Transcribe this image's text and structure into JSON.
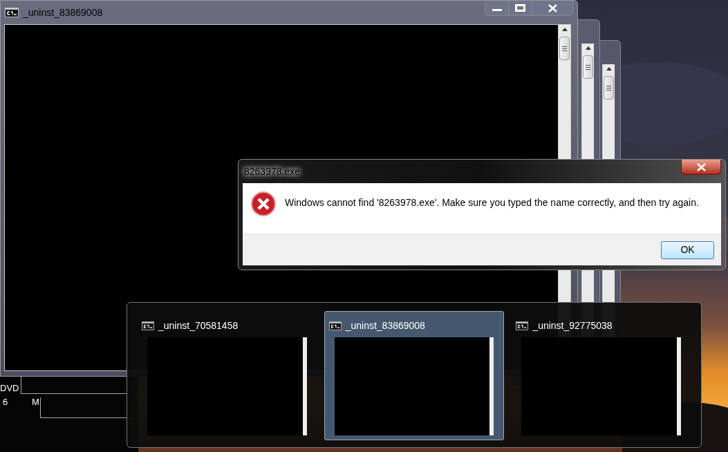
{
  "console_window": {
    "title": "_uninst_83869008"
  },
  "desktop_labels": [
    "DVD",
    "6",
    "M"
  ],
  "dialog": {
    "title": "8263978.exe",
    "message": "Windows cannot find '8263978.exe'. Make sure you typed the name correctly, and then try again.",
    "buttons": [
      "OK"
    ]
  },
  "switcher": {
    "items": [
      {
        "title": "_uninst_70581458",
        "selected": false
      },
      {
        "title": "_uninst_83869008",
        "selected": true
      },
      {
        "title": "_uninst_92775038",
        "selected": false
      }
    ]
  }
}
